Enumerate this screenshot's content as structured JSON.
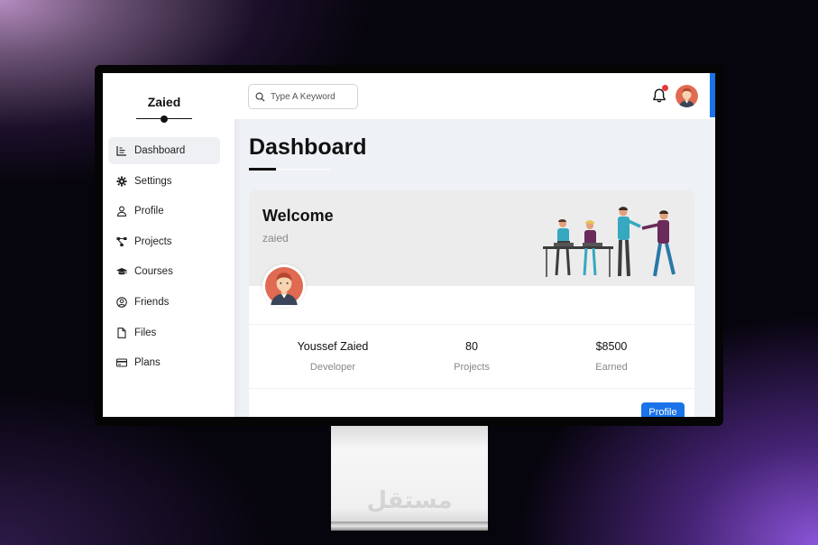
{
  "sidebar": {
    "brand": "Zaied",
    "items": [
      {
        "label": "Dashboard",
        "icon": "chart-line-icon",
        "active": true
      },
      {
        "label": "Settings",
        "icon": "gear-icon"
      },
      {
        "label": "Profile",
        "icon": "user-icon"
      },
      {
        "label": "Projects",
        "icon": "diagram-project-icon"
      },
      {
        "label": "Courses",
        "icon": "graduation-cap-icon"
      },
      {
        "label": "Friends",
        "icon": "user-circle-icon"
      },
      {
        "label": "Files",
        "icon": "file-icon"
      },
      {
        "label": "Plans",
        "icon": "credit-card-icon"
      }
    ]
  },
  "header": {
    "search_placeholder": "Type A Keyword",
    "notification_icon": "bell-icon",
    "accent_color": "#1a73e8"
  },
  "main": {
    "title": "Dashboard",
    "welcome": {
      "heading": "Welcome",
      "username": "zaied",
      "stats": [
        {
          "value": "Youssef Zaied",
          "label": "Developer"
        },
        {
          "value": "80",
          "label": "Projects"
        },
        {
          "value": "$8500",
          "label": "Earned"
        }
      ],
      "button_label": "Profile"
    }
  },
  "watermark": "مستقل"
}
